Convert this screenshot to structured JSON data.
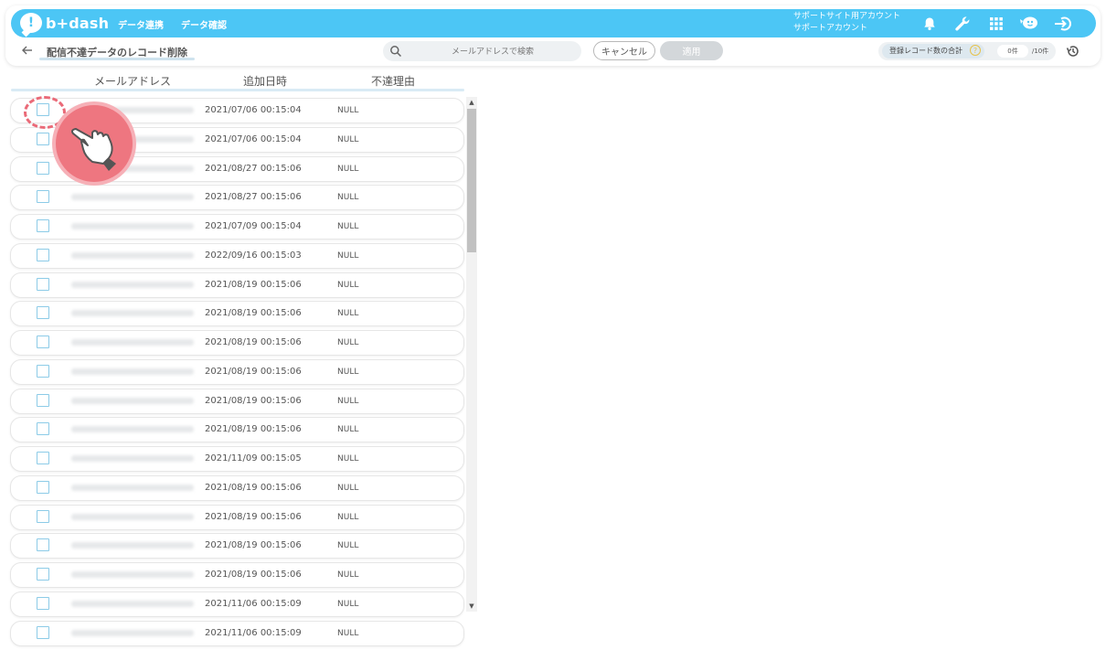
{
  "app": {
    "logo_text": "b+dash",
    "nav": [
      "データ連携",
      "データ確認"
    ],
    "account_lines": [
      "サポートサイト用アカウント",
      "サポートアカウント"
    ],
    "topbar_icons": [
      "bell-icon",
      "wrench-icon",
      "apps-grid-icon",
      "chat-bubble-icon",
      "logout-icon"
    ],
    "accent_color": "#4cc6f5"
  },
  "toolbar": {
    "page_title": "配信不達データのレコード削除",
    "search_placeholder": "メールアドレスで検索",
    "cancel_label": "キャンセル",
    "apply_label": "適用",
    "count_label": "登録レコード数の合計",
    "count_value": "0件",
    "count_max": "/10件"
  },
  "table": {
    "headers": [
      "メールアドレス",
      "追加日時",
      "不達理由"
    ],
    "rows": [
      {
        "date": "2021/07/06 00:15:04",
        "reason": "NULL"
      },
      {
        "date": "2021/07/06 00:15:04",
        "reason": "NULL"
      },
      {
        "date": "2021/08/27 00:15:06",
        "reason": "NULL"
      },
      {
        "date": "2021/08/27 00:15:06",
        "reason": "NULL"
      },
      {
        "date": "2021/07/09 00:15:04",
        "reason": "NULL"
      },
      {
        "date": "2022/09/16 00:15:03",
        "reason": "NULL"
      },
      {
        "date": "2021/08/19 00:15:06",
        "reason": "NULL"
      },
      {
        "date": "2021/08/19 00:15:06",
        "reason": "NULL"
      },
      {
        "date": "2021/08/19 00:15:06",
        "reason": "NULL"
      },
      {
        "date": "2021/08/19 00:15:06",
        "reason": "NULL"
      },
      {
        "date": "2021/08/19 00:15:06",
        "reason": "NULL"
      },
      {
        "date": "2021/08/19 00:15:06",
        "reason": "NULL"
      },
      {
        "date": "2021/11/09 00:15:05",
        "reason": "NULL"
      },
      {
        "date": "2021/08/19 00:15:06",
        "reason": "NULL"
      },
      {
        "date": "2021/08/19 00:15:06",
        "reason": "NULL"
      },
      {
        "date": "2021/08/19 00:15:06",
        "reason": "NULL"
      },
      {
        "date": "2021/08/19 00:15:06",
        "reason": "NULL"
      },
      {
        "date": "2021/11/06 00:15:09",
        "reason": "NULL"
      },
      {
        "date": "2021/11/06 00:15:09",
        "reason": "NULL"
      }
    ]
  }
}
